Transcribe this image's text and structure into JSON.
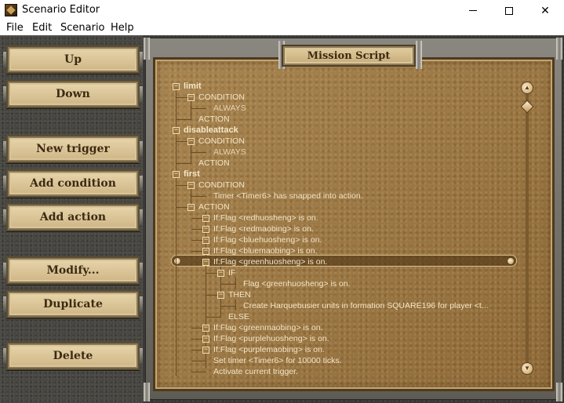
{
  "window": {
    "title": "Scenario Editor"
  },
  "menu": {
    "items": [
      "File",
      "Edit",
      "Scenario",
      "Help"
    ]
  },
  "buttons": {
    "up": "Up",
    "down": "Down",
    "new_trigger": "New trigger",
    "add_condition": "Add condition",
    "add_action": "Add action",
    "modify": "Modify...",
    "duplicate": "Duplicate",
    "delete": "Delete"
  },
  "panel": {
    "title": "Mission Script"
  },
  "tree": [
    {
      "text": "limit",
      "style": "head"
    },
    {
      "text": "CONDITION",
      "style": "label"
    },
    {
      "text": "ALWAYS",
      "style": "faded"
    },
    {
      "text": "ACTION",
      "style": "label"
    },
    {
      "text": "disableattack",
      "style": "head"
    },
    {
      "text": "CONDITION",
      "style": "label"
    },
    {
      "text": "ALWAYS",
      "style": "faded"
    },
    {
      "text": "ACTION",
      "style": "label"
    },
    {
      "text": "first",
      "style": "head"
    },
    {
      "text": "CONDITION",
      "style": "label"
    },
    {
      "text": "Timer <Timer6> has snapped into action.",
      "style": "label"
    },
    {
      "text": "ACTION",
      "style": "label"
    },
    {
      "text": "If:Flag <redhuosheng> is on.",
      "style": "label"
    },
    {
      "text": "If:Flag <redmaobing> is on.",
      "style": "label"
    },
    {
      "text": "If:Flag <bluehuosheng> is on.",
      "style": "label"
    },
    {
      "text": "If:Flag <bluemaobing> is on.",
      "style": "label"
    },
    {
      "text": "If:Flag <greenhuosheng> is on.",
      "style": "label"
    },
    {
      "text": "IF",
      "style": "label"
    },
    {
      "text": "Flag <greenhuosheng> is on.",
      "style": "label"
    },
    {
      "text": "THEN",
      "style": "label"
    },
    {
      "text": "Create Harquebusier  units in formation SQUARE196 for player <t...",
      "style": "label"
    },
    {
      "text": "ELSE",
      "style": "label"
    },
    {
      "text": "If:Flag <greenmaobing> is on.",
      "style": "label"
    },
    {
      "text": "If:Flag <purplehuosheng> is on.",
      "style": "label"
    },
    {
      "text": "If:Flag <purplemaobing> is on.",
      "style": "label"
    },
    {
      "text": "Set timer <Timer6> for 10000 ticks.",
      "style": "label"
    },
    {
      "text": "Activate current trigger.",
      "style": "label"
    }
  ],
  "selected_index": 16,
  "colors": {
    "parchment": "#a07a45",
    "button_face": "#e3cfa1",
    "tree_text": "#f4e6c6"
  },
  "icons": {
    "collapse": "minus-box",
    "scroll_up": "up-arrow",
    "scroll_down": "down-arrow"
  }
}
